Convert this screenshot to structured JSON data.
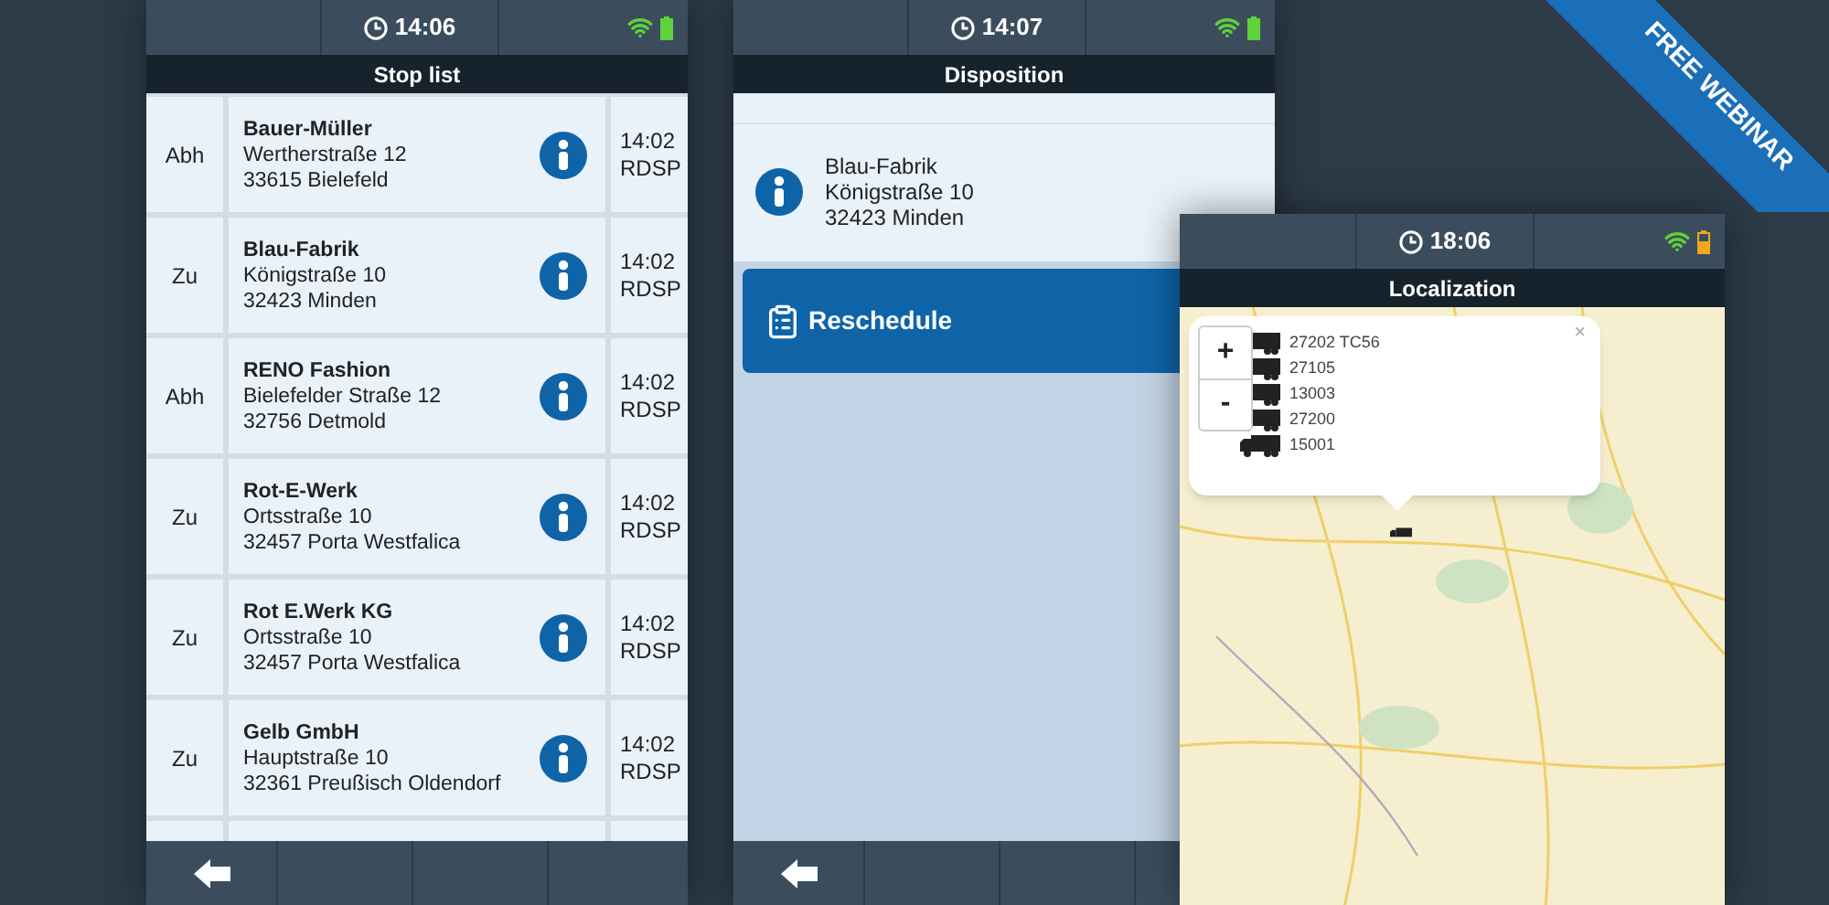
{
  "phones": [
    {
      "kind": "stop_list",
      "time": "14:06",
      "battery_low": false,
      "title": "Stop list",
      "stops": [
        {
          "status": "Abh",
          "name": "Bauer-Müller",
          "street": "Wertherstraße 12",
          "city": "33615 Bielefeld",
          "time": "14:02",
          "code": "RDSP"
        },
        {
          "status": "Zu",
          "name": "Blau-Fabrik",
          "street": "Königstraße 10",
          "city": "32423 Minden",
          "time": "14:02",
          "code": "RDSP"
        },
        {
          "status": "Abh",
          "name": "RENO Fashion",
          "street": "Bielefelder Straße 12",
          "city": "32756 Detmold",
          "time": "14:02",
          "code": "RDSP"
        },
        {
          "status": "Zu",
          "name": "Rot-E-Werk",
          "street": "Ortsstraße 10",
          "city": "32457 Porta Westfalica",
          "time": "14:02",
          "code": "RDSP"
        },
        {
          "status": "Zu",
          "name": "Rot E.Werk KG",
          "street": "Ortsstraße 10",
          "city": "32457 Porta Westfalica",
          "time": "14:02",
          "code": "RDSP"
        },
        {
          "status": "Zu",
          "name": "Gelb GmbH",
          "street": "Hauptstraße 10",
          "city": "32361 Preußisch Oldendorf",
          "time": "14:02",
          "code": "RDSP"
        }
      ]
    },
    {
      "kind": "disposition",
      "time": "14:07",
      "battery_low": false,
      "title": "Disposition",
      "address": [
        "Blau-Fabrik",
        "Königstraße 10",
        "32423 Minden"
      ],
      "action": "Reschedule"
    },
    {
      "kind": "map",
      "time": "18:06",
      "battery_low": true,
      "title": "Localization",
      "zoom_in": "+",
      "zoom_out": "-",
      "close": "×",
      "vehicles": [
        "27202 TC56",
        "27105",
        "13003",
        "27200",
        "15001"
      ]
    }
  ],
  "ribbon": "FREE WEBINAR"
}
